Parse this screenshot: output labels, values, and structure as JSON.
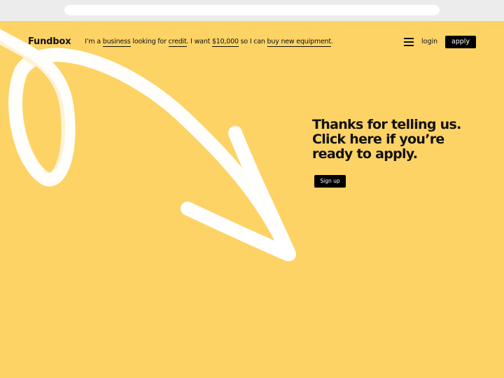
{
  "colors": {
    "page_background": "#fdd366",
    "button_background": "#000000",
    "arrow": "#ffffff"
  },
  "header": {
    "logo": "Fundbox",
    "sentence": {
      "intro": "I’m a ",
      "business_option": "business",
      "looking_for": " looking for ",
      "credit_option": "credit",
      "i_want": ". I want ",
      "amount_option": "$10,000",
      "so_i_can": " so I can ",
      "purpose_option": "buy new equipment",
      "end": "."
    },
    "menu_icon": "hamburger-menu-icon",
    "login_label": "login",
    "apply_label": "apply"
  },
  "hero": {
    "headline": "Thanks for telling us. Click here if you’re ready to apply.",
    "signup_label": "Sign up",
    "decoration_icon": "brush-arrow-icon"
  }
}
